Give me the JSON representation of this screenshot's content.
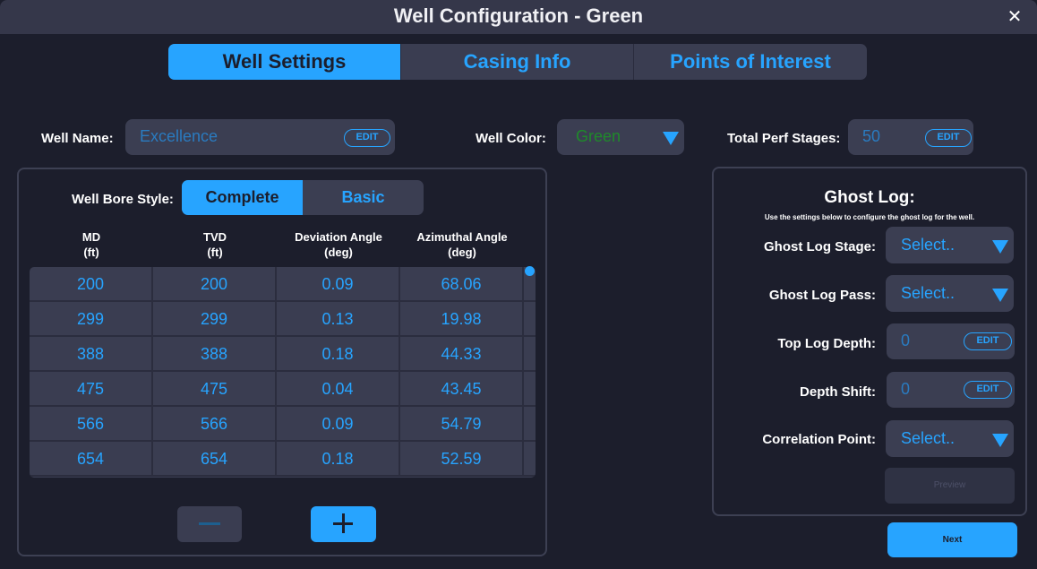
{
  "window": {
    "title": "Well Configuration - Green",
    "close_glyph": "✕"
  },
  "tabs": [
    {
      "label": "Well Settings",
      "active": true
    },
    {
      "label": "Casing Info",
      "active": false
    },
    {
      "label": "Points of Interest",
      "active": false
    }
  ],
  "well_name": {
    "label": "Well Name:",
    "value": "Excellence",
    "edit_label": "EDIT"
  },
  "well_color": {
    "label": "Well Color:",
    "value": "Green",
    "value_color": "#1f8a2a",
    "icon": "caret-down-icon"
  },
  "perf_stages": {
    "label": "Total Perf Stages:",
    "value": "50",
    "edit_label": "EDIT"
  },
  "bore": {
    "label": "Well Bore Style:",
    "options": [
      "Complete",
      "Basic"
    ],
    "selected": "Complete"
  },
  "table": {
    "columns": [
      {
        "name": "MD",
        "unit": "(ft)"
      },
      {
        "name": "TVD",
        "unit": "(ft)"
      },
      {
        "name": "Deviation Angle",
        "unit": "(deg)"
      },
      {
        "name": "Azimuthal Angle",
        "unit": "(deg)"
      }
    ],
    "rows": [
      [
        "200",
        "200",
        "0.09",
        "68.06"
      ],
      [
        "299",
        "299",
        "0.13",
        "19.98"
      ],
      [
        "388",
        "388",
        "0.18",
        "44.33"
      ],
      [
        "475",
        "475",
        "0.04",
        "43.45"
      ],
      [
        "566",
        "566",
        "0.09",
        "54.79"
      ],
      [
        "654",
        "654",
        "0.18",
        "52.59"
      ]
    ]
  },
  "row_buttons": {
    "remove_icon": "minus-icon",
    "add_icon": "plus-icon"
  },
  "ghost_log": {
    "title": "Ghost Log:",
    "subtitle": "Use the settings below to configure the ghost log for the well.",
    "stage": {
      "label": "Ghost Log Stage:",
      "value": "Select.."
    },
    "pass": {
      "label": "Ghost Log Pass:",
      "value": "Select.."
    },
    "top_depth": {
      "label": "Top Log Depth:",
      "value": "0",
      "edit_label": "EDIT"
    },
    "depth_shift": {
      "label": "Depth Shift:",
      "value": "0",
      "edit_label": "EDIT"
    },
    "correlation": {
      "label": "Correlation Point:",
      "value": "Select.."
    },
    "preview_label": "Preview"
  },
  "next_label": "Next",
  "colors": {
    "accent": "#27a4ff",
    "background": "#1c1e2c",
    "surface": "#3b3e52"
  }
}
